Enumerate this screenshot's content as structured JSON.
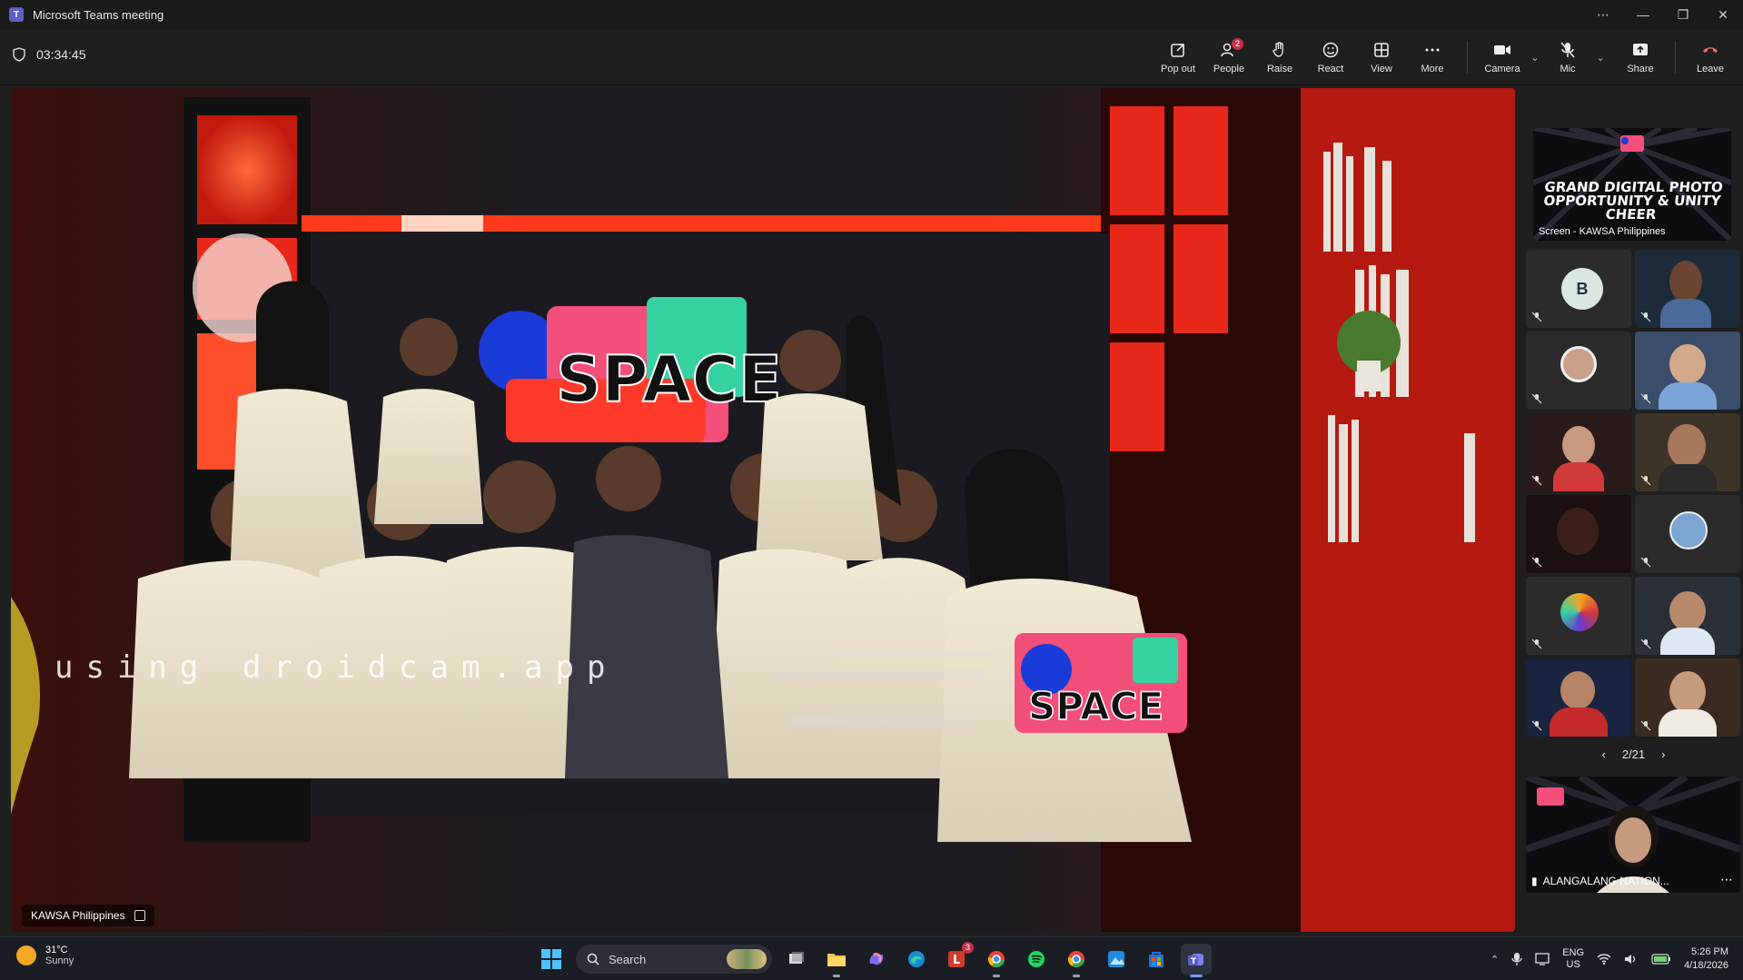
{
  "window": {
    "title": "Microsoft Teams meeting"
  },
  "toolbar": {
    "timer": "03:34:45",
    "buttons": [
      {
        "label": "Pop out",
        "icon": "pop-out-icon"
      },
      {
        "label": "People",
        "icon": "people-icon",
        "badge": "2"
      },
      {
        "label": "Raise",
        "icon": "hand-icon"
      },
      {
        "label": "React",
        "icon": "smile-icon"
      },
      {
        "label": "View",
        "icon": "grid-icon"
      },
      {
        "label": "More",
        "icon": "more-icon"
      }
    ],
    "camera_label": "Camera",
    "mic_label": "Mic",
    "share_label": "Share",
    "leave_label": "Leave",
    "leave_color": "#f26b6b"
  },
  "stage": {
    "watermark": "using droidcam.app",
    "participant_name": "KAWSA Philippines"
  },
  "panel": {
    "screen_share": {
      "heading_line1": "GRAND DIGITAL PHOTO",
      "heading_line2": "OPPORTUNITY & UNITY CHEER",
      "caption": "Screen - KAWSA Philippines"
    },
    "avatar_initial": "B",
    "page_indicator": "2/21",
    "self_view_name": "ALANGALANG NATION..."
  },
  "taskbar": {
    "weather_temp": "31°C",
    "weather_desc": "Sunny",
    "search_placeholder": "Search",
    "lang_line1": "ENG",
    "lang_line2": "US",
    "time": "5:26 PM",
    "date": "4/18/2026",
    "notification_badge": "3"
  },
  "colors": {
    "teams_accent": "#5b5fc7",
    "badge_red": "#c4314b"
  }
}
